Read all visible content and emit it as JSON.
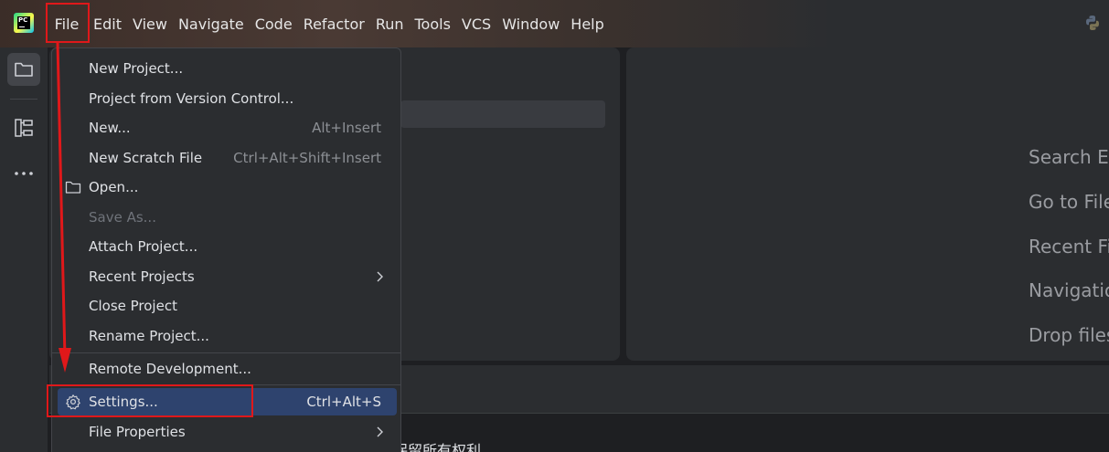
{
  "menubar": {
    "items": [
      "File",
      "Edit",
      "View",
      "Navigate",
      "Code",
      "Refactor",
      "Run",
      "Tools",
      "VCS",
      "Window",
      "Help"
    ]
  },
  "icons": {
    "app_logo": "pycharm-logo-icon",
    "app_logo_text": "PC",
    "python": "python-icon",
    "project": "folder-icon",
    "structure": "structure-icon",
    "more": "more-icon"
  },
  "file_menu": {
    "items": [
      {
        "label": "New Project...",
        "shortcut": ""
      },
      {
        "label": "Project from Version Control...",
        "shortcut": ""
      },
      {
        "label": "New...",
        "shortcut": "Alt+Insert"
      },
      {
        "label": "New Scratch File",
        "shortcut": "Ctrl+Alt+Shift+Insert"
      },
      {
        "label": "Open...",
        "shortcut": "",
        "icon": "folder-icon"
      },
      {
        "label": "Save As...",
        "shortcut": "",
        "disabled": true
      },
      {
        "label": "Attach Project...",
        "shortcut": ""
      },
      {
        "label": "Recent Projects",
        "shortcut": "",
        "submenu": true
      },
      {
        "label": "Close Project",
        "shortcut": ""
      },
      {
        "label": "Rename Project...",
        "shortcut": ""
      },
      {
        "label": "Remote Development...",
        "shortcut": ""
      },
      {
        "label": "Settings...",
        "shortcut": "Ctrl+Alt+S",
        "icon": "gear-icon",
        "selected": true
      },
      {
        "label": "File Properties",
        "shortcut": "",
        "submenu": true
      }
    ]
  },
  "welcome_hints": [
    "Search Ev",
    "Go to File",
    "Recent Fi",
    "Navigatio",
    "Drop files"
  ],
  "footer_text": "保留所有权利",
  "colors": {
    "accent_selection": "#2e436e",
    "annotation_red": "#e0181a",
    "panel_bg": "#2b2d30",
    "window_bg": "#1e1f22"
  }
}
